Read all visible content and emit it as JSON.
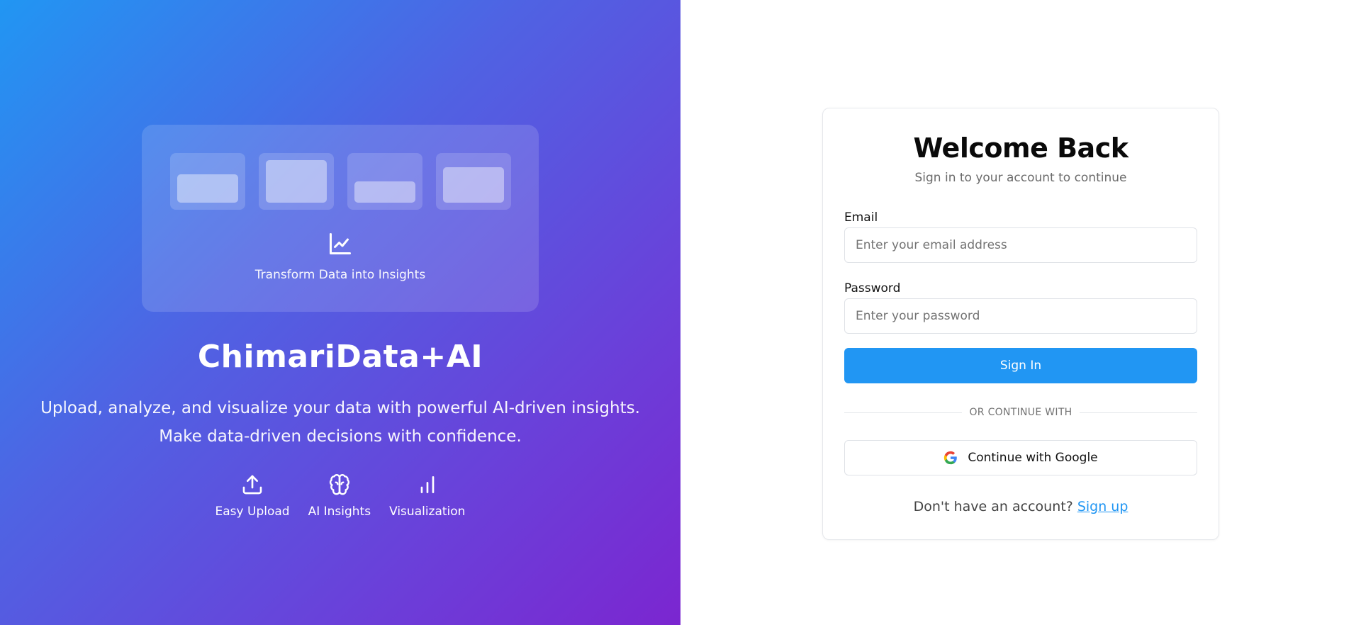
{
  "hero": {
    "card_caption": "Transform Data into Insights",
    "brand": "ChimariData+AI",
    "tagline_line1": "Upload, analyze, and visualize your data with powerful AI-driven insights.",
    "tagline_line2": "Make data-driven decisions with confidence.",
    "features": [
      {
        "icon": "upload-icon",
        "label": "Easy Upload"
      },
      {
        "icon": "brain-icon",
        "label": "AI Insights"
      },
      {
        "icon": "bar-chart-icon",
        "label": "Visualization"
      }
    ]
  },
  "auth": {
    "title": "Welcome Back",
    "subtitle": "Sign in to your account to continue",
    "email": {
      "label": "Email",
      "placeholder": "Enter your email address",
      "value": ""
    },
    "password": {
      "label": "Password",
      "placeholder": "Enter your password",
      "value": ""
    },
    "sign_in_label": "Sign In",
    "divider_text": "OR CONTINUE WITH",
    "google_label": "Continue with Google",
    "signup_prompt": "Don't have an account?",
    "signup_link": "Sign up"
  },
  "colors": {
    "primary": "#2196f3",
    "gradient_start": "#2196f3",
    "gradient_end": "#7b26d0"
  }
}
